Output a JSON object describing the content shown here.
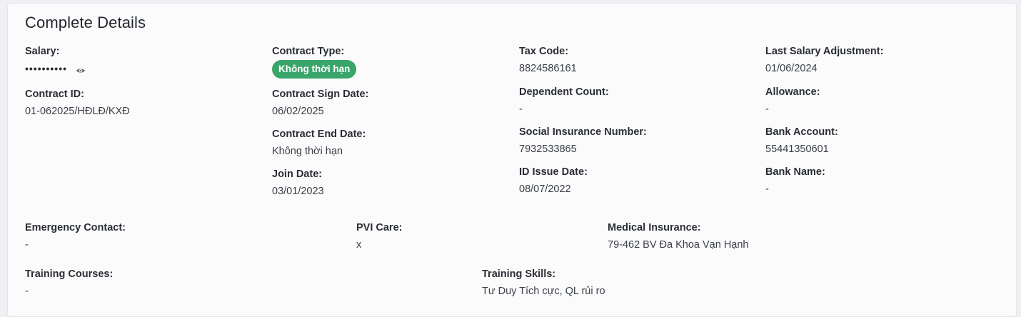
{
  "section": {
    "title": "Complete Details"
  },
  "col1": {
    "salary_label": "Salary:",
    "salary_masked": "••••••••••",
    "contract_id_label": "Contract ID:",
    "contract_id_value": "01-062025/HĐLĐ/KXĐ"
  },
  "col2": {
    "contract_type_label": "Contract Type:",
    "contract_type_value": "Không thời hạn",
    "contract_sign_label": "Contract Sign Date:",
    "contract_sign_value": "06/02/2025",
    "contract_end_label": "Contract End Date:",
    "contract_end_value": "Không thời hạn",
    "join_date_label": "Join Date:",
    "join_date_value": "03/01/2023"
  },
  "col3": {
    "tax_code_label": "Tax Code:",
    "tax_code_value": "8824586161",
    "dependent_label": "Dependent Count:",
    "dependent_value": "-",
    "social_label": "Social Insurance Number:",
    "social_value": "7932533865",
    "id_issue_label": "ID Issue Date:",
    "id_issue_value": "08/07/2022"
  },
  "col4": {
    "last_salary_label": "Last Salary Adjustment:",
    "last_salary_value": "01/06/2024",
    "allowance_label": "Allowance:",
    "allowance_value": "-",
    "bank_account_label": "Bank Account:",
    "bank_account_value": "55441350601",
    "bank_name_label": "Bank Name:",
    "bank_name_value": "-"
  },
  "row2": {
    "emergency_label": "Emergency Contact:",
    "emergency_value": "-",
    "pvi_label": "PVI Care:",
    "pvi_value": "x",
    "medical_label": "Medical Insurance:",
    "medical_value": "79-462 BV Đa Khoa Vạn Hạnh"
  },
  "row3": {
    "training_courses_label": "Training Courses:",
    "training_courses_value": "-",
    "training_skills_label": "Training Skills:",
    "training_skills_value": "Tư Duy Tích cực, QL rủi ro"
  },
  "icons": {
    "reveal": "eye-icon"
  },
  "colors": {
    "badge": "#3aa56a",
    "card": "#fbfbfc"
  }
}
